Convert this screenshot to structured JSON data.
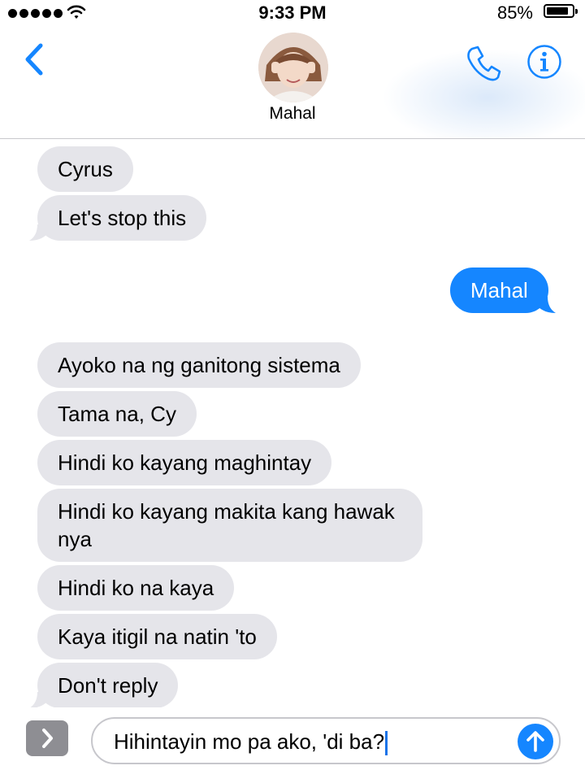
{
  "status_bar": {
    "time": "9:33 PM",
    "battery_percent": "85%",
    "battery_level": 0.85,
    "signal_bars": 5,
    "icons": [
      "signal-dots-icon",
      "wifi-icon",
      "battery-icon"
    ]
  },
  "header": {
    "contact_name": "Mahal",
    "icons": {
      "back": "chevron-left-icon",
      "call": "phone-icon",
      "info": "info-icon"
    }
  },
  "colors": {
    "accent": "#1586ff",
    "incoming_bubble": "#e5e5ea",
    "outgoing_bubble": "#1586ff"
  },
  "messages": [
    {
      "direction": "incoming",
      "text": "Cyrus"
    },
    {
      "direction": "incoming",
      "text": "Let's stop this"
    },
    {
      "direction": "outgoing",
      "text": "Mahal"
    },
    {
      "direction": "incoming",
      "text": "Ayoko na ng ganitong sistema"
    },
    {
      "direction": "incoming",
      "text": "Tama na, Cy"
    },
    {
      "direction": "incoming",
      "text": "Hindi ko kayang maghintay"
    },
    {
      "direction": "incoming",
      "text": "Hindi ko kayang makita kang hawak",
      "text_line2": "nya"
    },
    {
      "direction": "incoming",
      "text": "Hindi ko na kaya"
    },
    {
      "direction": "incoming",
      "text": "Kaya itigil na natin 'to"
    },
    {
      "direction": "incoming",
      "text": "Don't reply"
    }
  ],
  "composer": {
    "text": "Hihintayin mo pa ako, 'di ba?",
    "icons": {
      "apps": "chevron-right-icon",
      "send": "arrow-up-icon"
    }
  }
}
